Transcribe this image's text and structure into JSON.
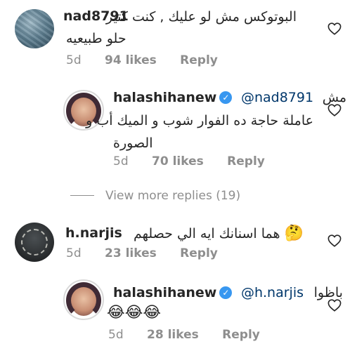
{
  "comments": [
    {
      "username": "nad8791",
      "text_line1": "البوتوكس مش لو عليك , كنت كتير",
      "text_line2": "حلو طبيعيه",
      "age": "5d",
      "likes": "94 likes",
      "reply": "Reply"
    },
    {
      "username": "halashihanew",
      "mention": "@nad8791",
      "text_line1": "مش",
      "text_line2": "عاملة حاجة ده الفوار شوب و الميك أب و",
      "text_line3": "الصورة",
      "age": "5d",
      "likes": "70 likes",
      "reply": "Reply"
    },
    {
      "username": "h.narjis",
      "text": "هما اسنانك ايه الي حصلهم",
      "emoji": "🤔",
      "age": "5d",
      "likes": "23 likes",
      "reply": "Reply"
    },
    {
      "username": "halashihanew",
      "mention": "@h.narjis",
      "text_line1": "باظوا",
      "text_line2": "😂😂😂",
      "age": "5d",
      "likes": "28 likes",
      "reply": "Reply"
    }
  ],
  "view_more": "View more replies (19)",
  "icons": {
    "verified": "verified-badge-icon",
    "like": "heart-outline-icon"
  },
  "colors": {
    "verified_blue": "#3897f0",
    "mention_link": "#00376b",
    "meta_gray": "#8e8e8e"
  }
}
